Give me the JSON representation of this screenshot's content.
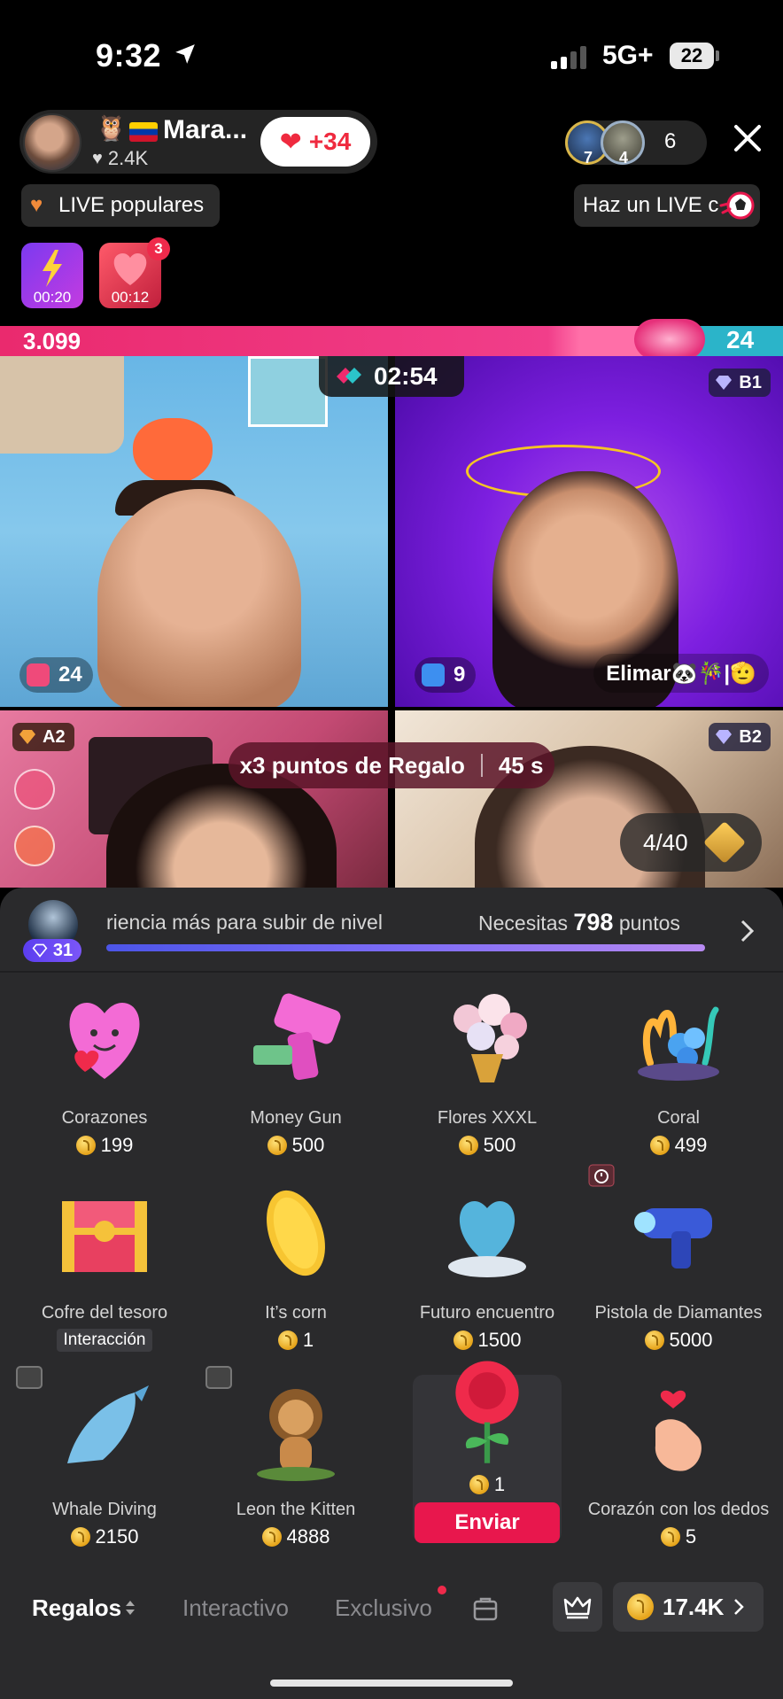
{
  "status_bar": {
    "time": "9:32",
    "network": "5G+",
    "battery": "22"
  },
  "host": {
    "name": "Mara...",
    "likes": "2.4K",
    "like_delta": "+34"
  },
  "viewers": {
    "avatar_badges": [
      "7",
      "4"
    ],
    "count": "6"
  },
  "chips": {
    "popular": "LIVE populares",
    "go_live": "Haz un LIVE c"
  },
  "mini_cards": [
    {
      "timer": "00:20"
    },
    {
      "timer": "00:12",
      "badge": "3"
    }
  ],
  "battle": {
    "left_score": "3.099",
    "right_score": "24",
    "timer": "02:54",
    "tiles": [
      {
        "score": "24",
        "rank": ""
      },
      {
        "score": "9",
        "rank": "B1",
        "name": "Elimar🐼🎋|🫡"
      },
      {
        "rank": "A2"
      },
      {
        "rank": "B2"
      }
    ],
    "points_banner": {
      "text": "x3 puntos de Regalo",
      "time": "45 s"
    },
    "progress": "4/40"
  },
  "level": {
    "badge": "31",
    "text": "riencia más para subir de nivel",
    "need_prefix": "Necesitas",
    "need_value": "798",
    "need_suffix": "puntos"
  },
  "gifts": [
    {
      "name": "Corazones",
      "price": "199"
    },
    {
      "name": "Money Gun",
      "price": "500"
    },
    {
      "name": "Flores XXXL",
      "price": "500"
    },
    {
      "name": "Coral",
      "price": "499"
    },
    {
      "name": "Cofre del tesoro",
      "tag": "Interacción"
    },
    {
      "name": "It’s corn",
      "price": "1"
    },
    {
      "name": "Futuro encuentro",
      "price": "1500"
    },
    {
      "name": "Pistola de Diamantes",
      "price": "5000"
    },
    {
      "name": "Whale Diving",
      "price": "2150"
    },
    {
      "name": "Leon the Kitten",
      "price": "4888"
    },
    {
      "name": "",
      "price": "1",
      "selected": true
    },
    {
      "name": "Corazón con los dedos",
      "price": "5"
    }
  ],
  "send_label": "Enviar",
  "tabs": {
    "gifts": "Regalos",
    "interactive": "Interactivo",
    "exclusive": "Exclusivo"
  },
  "coins": "17.4K",
  "colors": {
    "accent": "#E8174D",
    "battle_left": "#EA2A6E",
    "battle_right": "#2BB4C9",
    "panel_bg": "#2A2A2C"
  }
}
